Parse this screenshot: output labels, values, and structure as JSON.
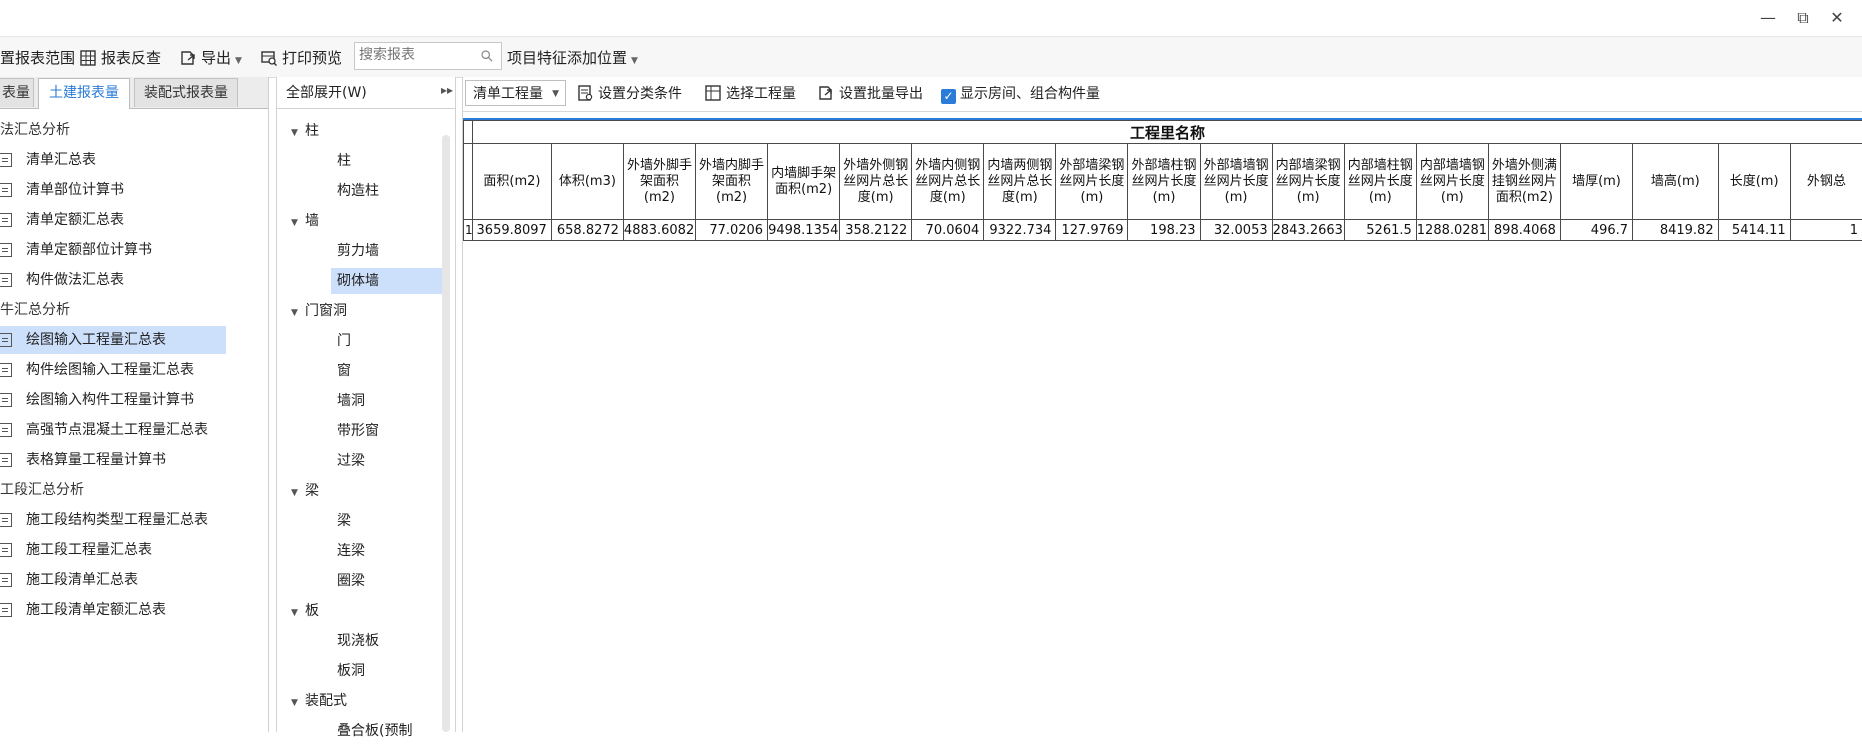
{
  "window": {
    "minimize": "—",
    "restore": "⧉",
    "close": "✕"
  },
  "toolbar": {
    "set_range": "置报表范围",
    "report_check": "报表反查",
    "export": "导出",
    "print_preview": "打印预览",
    "search_placeholder": "搜索报表",
    "add_position": "项目特征添加位置"
  },
  "tabs": [
    "表量",
    "土建报表量",
    "装配式报表量"
  ],
  "left_groups": [
    {
      "header": "法汇总分析",
      "items": [
        "清单汇总表",
        "清单部位计算书",
        "清单定额汇总表",
        "清单定额部位计算书",
        "构件做法汇总表"
      ]
    },
    {
      "header": "牛汇总分析",
      "items": [
        "绘图输入工程量汇总表",
        "构件绘图输入工程量汇总表",
        "绘图输入构件工程量计算书",
        "高强节点混凝土工程量汇总表",
        "表格算量工程量计算书"
      ]
    },
    {
      "header": "工段汇总分析",
      "items": [
        "施工段结构类型工程量汇总表",
        "施工段工程量汇总表",
        "施工段清单汇总表",
        "施工段清单定额汇总表"
      ]
    }
  ],
  "tree": {
    "expand_all": "全部展开(W)",
    "nodes": [
      {
        "label": "柱",
        "level": 0
      },
      {
        "label": "柱",
        "level": 1
      },
      {
        "label": "构造柱",
        "level": 1
      },
      {
        "label": "墙",
        "level": 0
      },
      {
        "label": "剪力墙",
        "level": 1
      },
      {
        "label": "砌体墙",
        "level": 1
      },
      {
        "label": "门窗洞",
        "level": 0
      },
      {
        "label": "门",
        "level": 1
      },
      {
        "label": "窗",
        "level": 1
      },
      {
        "label": "墙洞",
        "level": 1
      },
      {
        "label": "带形窗",
        "level": 1
      },
      {
        "label": "过梁",
        "level": 1
      },
      {
        "label": "梁",
        "level": 0
      },
      {
        "label": "梁",
        "level": 1
      },
      {
        "label": "连梁",
        "level": 1
      },
      {
        "label": "圈梁",
        "level": 1
      },
      {
        "label": "板",
        "level": 0
      },
      {
        "label": "现浇板",
        "level": 1
      },
      {
        "label": "板洞",
        "level": 1
      },
      {
        "label": "装配式",
        "level": 0
      },
      {
        "label": "叠合板(预制",
        "level": 1
      }
    ]
  },
  "right_toolbar": {
    "quantity_type": "清单工程量",
    "set_classify": "设置分类条件",
    "select_qty": "选择工程量",
    "batch_export": "设置批量导出",
    "show_rooms": "显示房间、组合构件量"
  },
  "table": {
    "group_title": "工程里名称",
    "columns": [
      "面积(m2)",
      "体积(m3)",
      "外墙外脚手架面积(m2)",
      "外墙内脚手架面积(m2)",
      "内墙脚手架面积(m2)",
      "外墙外侧钢丝网片总长度(m)",
      "外墙内侧钢丝网片总长度(m)",
      "内墙两侧钢丝网片总长度(m)",
      "外部墙梁钢丝网片长度(m)",
      "外部墙柱钢丝网片长度(m)",
      "外部墙墙钢丝网片长度(m)",
      "内部墙梁钢丝网片长度(m)",
      "内部墙柱钢丝网片长度(m)",
      "内部墙墙钢丝网片长度(m)",
      "外墙外侧满挂钢丝网片面积(m2)",
      "墙厚(m)",
      "墙高(m)",
      "长度(m)",
      "外钢总"
    ],
    "rows": [
      {
        "num": "1",
        "cells": [
          "3659.8097",
          "658.8272",
          "4883.6082",
          "77.0206",
          "9498.1354",
          "358.2122",
          "70.0604",
          "9322.734",
          "127.9769",
          "198.23",
          "32.0053",
          "2843.2663",
          "5261.5",
          "1288.0281",
          "898.4068",
          "496.7",
          "8419.82",
          "5414.11",
          "1"
        ]
      }
    ]
  },
  "colors": {
    "accent": "#2b7bd8",
    "selected_bg": "#cde0fb"
  }
}
